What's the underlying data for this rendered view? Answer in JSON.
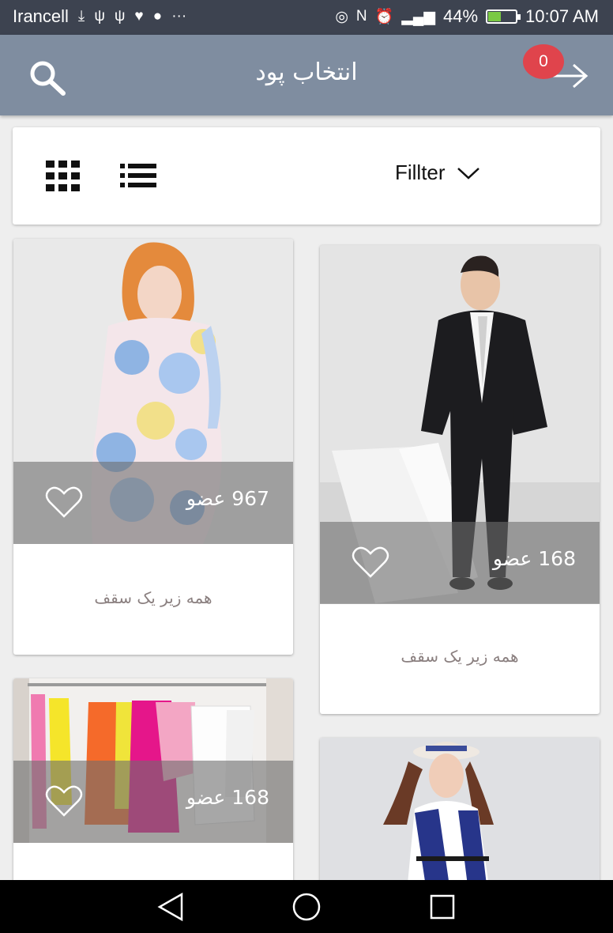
{
  "status_bar": {
    "carrier": "Irancell",
    "battery": "44%",
    "time": "10:07 AM",
    "battery_level": 0.44
  },
  "app_bar": {
    "title": "انتخاب پود",
    "cart_count": "0",
    "accent_color": "#7f8da0",
    "badge_color": "#e0444c"
  },
  "toolbar": {
    "filter_label": "Fillter"
  },
  "products": [
    {
      "count": "967 عضو",
      "caption": "همه زیر یک سقف"
    },
    {
      "count": "168 عضو",
      "caption": "همه زیر یک سقف"
    },
    {
      "count": "168 عضو",
      "caption": ""
    },
    {
      "count": "",
      "caption": ""
    }
  ]
}
